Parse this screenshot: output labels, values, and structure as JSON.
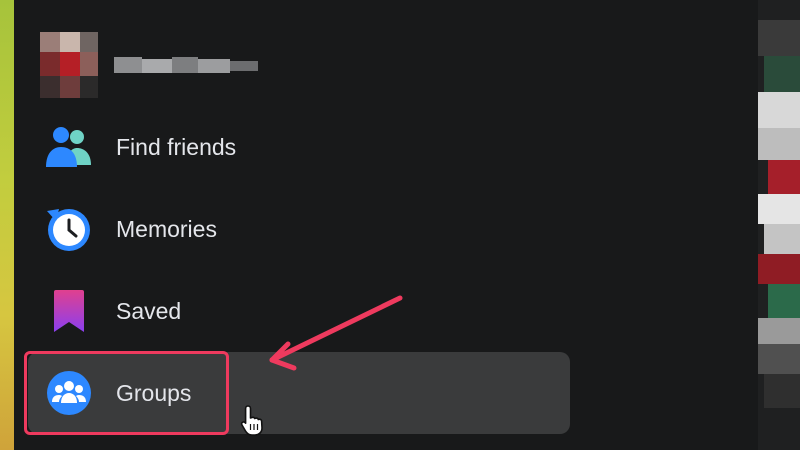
{
  "profile": {
    "name_redacted": true
  },
  "menu": {
    "items": [
      {
        "id": "find-friends",
        "label": "Find friends",
        "icon": "friends-icon"
      },
      {
        "id": "memories",
        "label": "Memories",
        "icon": "clock-icon"
      },
      {
        "id": "saved",
        "label": "Saved",
        "icon": "bookmark-icon"
      },
      {
        "id": "groups",
        "label": "Groups",
        "icon": "groups-icon",
        "hovered": true
      }
    ]
  },
  "annotation": {
    "highlight_color": "#ee3a5e"
  },
  "colors": {
    "background": "#18191a",
    "hover": "#3a3b3c",
    "text": "#e4e6eb",
    "accent_blue": "#2d88ff"
  }
}
